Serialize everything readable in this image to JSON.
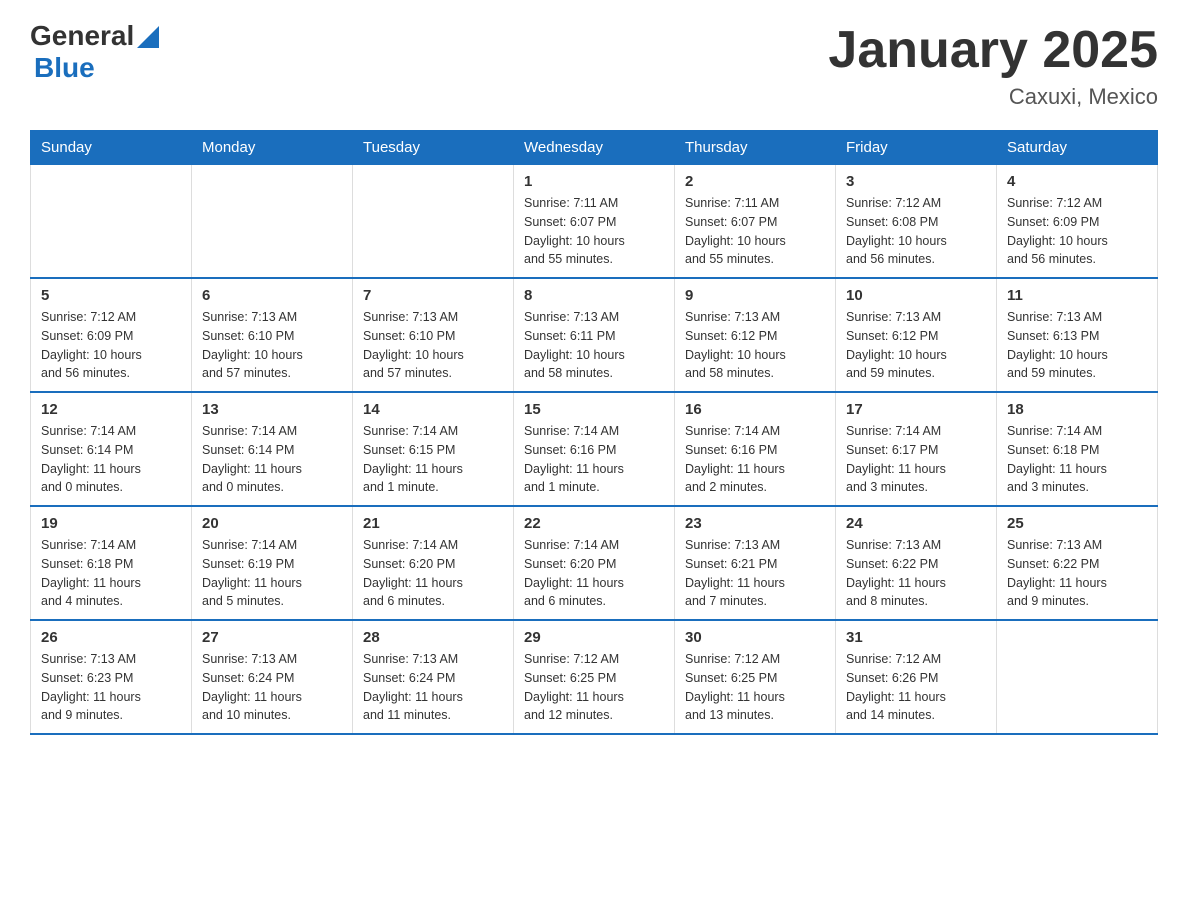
{
  "header": {
    "title": "January 2025",
    "subtitle": "Caxuxi, Mexico",
    "logo_general": "General",
    "logo_blue": "Blue"
  },
  "days_of_week": [
    "Sunday",
    "Monday",
    "Tuesday",
    "Wednesday",
    "Thursday",
    "Friday",
    "Saturday"
  ],
  "weeks": [
    [
      {
        "day": "",
        "info": ""
      },
      {
        "day": "",
        "info": ""
      },
      {
        "day": "",
        "info": ""
      },
      {
        "day": "1",
        "info": "Sunrise: 7:11 AM\nSunset: 6:07 PM\nDaylight: 10 hours\nand 55 minutes."
      },
      {
        "day": "2",
        "info": "Sunrise: 7:11 AM\nSunset: 6:07 PM\nDaylight: 10 hours\nand 55 minutes."
      },
      {
        "day": "3",
        "info": "Sunrise: 7:12 AM\nSunset: 6:08 PM\nDaylight: 10 hours\nand 56 minutes."
      },
      {
        "day": "4",
        "info": "Sunrise: 7:12 AM\nSunset: 6:09 PM\nDaylight: 10 hours\nand 56 minutes."
      }
    ],
    [
      {
        "day": "5",
        "info": "Sunrise: 7:12 AM\nSunset: 6:09 PM\nDaylight: 10 hours\nand 56 minutes."
      },
      {
        "day": "6",
        "info": "Sunrise: 7:13 AM\nSunset: 6:10 PM\nDaylight: 10 hours\nand 57 minutes."
      },
      {
        "day": "7",
        "info": "Sunrise: 7:13 AM\nSunset: 6:10 PM\nDaylight: 10 hours\nand 57 minutes."
      },
      {
        "day": "8",
        "info": "Sunrise: 7:13 AM\nSunset: 6:11 PM\nDaylight: 10 hours\nand 58 minutes."
      },
      {
        "day": "9",
        "info": "Sunrise: 7:13 AM\nSunset: 6:12 PM\nDaylight: 10 hours\nand 58 minutes."
      },
      {
        "day": "10",
        "info": "Sunrise: 7:13 AM\nSunset: 6:12 PM\nDaylight: 10 hours\nand 59 minutes."
      },
      {
        "day": "11",
        "info": "Sunrise: 7:13 AM\nSunset: 6:13 PM\nDaylight: 10 hours\nand 59 minutes."
      }
    ],
    [
      {
        "day": "12",
        "info": "Sunrise: 7:14 AM\nSunset: 6:14 PM\nDaylight: 11 hours\nand 0 minutes."
      },
      {
        "day": "13",
        "info": "Sunrise: 7:14 AM\nSunset: 6:14 PM\nDaylight: 11 hours\nand 0 minutes."
      },
      {
        "day": "14",
        "info": "Sunrise: 7:14 AM\nSunset: 6:15 PM\nDaylight: 11 hours\nand 1 minute."
      },
      {
        "day": "15",
        "info": "Sunrise: 7:14 AM\nSunset: 6:16 PM\nDaylight: 11 hours\nand 1 minute."
      },
      {
        "day": "16",
        "info": "Sunrise: 7:14 AM\nSunset: 6:16 PM\nDaylight: 11 hours\nand 2 minutes."
      },
      {
        "day": "17",
        "info": "Sunrise: 7:14 AM\nSunset: 6:17 PM\nDaylight: 11 hours\nand 3 minutes."
      },
      {
        "day": "18",
        "info": "Sunrise: 7:14 AM\nSunset: 6:18 PM\nDaylight: 11 hours\nand 3 minutes."
      }
    ],
    [
      {
        "day": "19",
        "info": "Sunrise: 7:14 AM\nSunset: 6:18 PM\nDaylight: 11 hours\nand 4 minutes."
      },
      {
        "day": "20",
        "info": "Sunrise: 7:14 AM\nSunset: 6:19 PM\nDaylight: 11 hours\nand 5 minutes."
      },
      {
        "day": "21",
        "info": "Sunrise: 7:14 AM\nSunset: 6:20 PM\nDaylight: 11 hours\nand 6 minutes."
      },
      {
        "day": "22",
        "info": "Sunrise: 7:14 AM\nSunset: 6:20 PM\nDaylight: 11 hours\nand 6 minutes."
      },
      {
        "day": "23",
        "info": "Sunrise: 7:13 AM\nSunset: 6:21 PM\nDaylight: 11 hours\nand 7 minutes."
      },
      {
        "day": "24",
        "info": "Sunrise: 7:13 AM\nSunset: 6:22 PM\nDaylight: 11 hours\nand 8 minutes."
      },
      {
        "day": "25",
        "info": "Sunrise: 7:13 AM\nSunset: 6:22 PM\nDaylight: 11 hours\nand 9 minutes."
      }
    ],
    [
      {
        "day": "26",
        "info": "Sunrise: 7:13 AM\nSunset: 6:23 PM\nDaylight: 11 hours\nand 9 minutes."
      },
      {
        "day": "27",
        "info": "Sunrise: 7:13 AM\nSunset: 6:24 PM\nDaylight: 11 hours\nand 10 minutes."
      },
      {
        "day": "28",
        "info": "Sunrise: 7:13 AM\nSunset: 6:24 PM\nDaylight: 11 hours\nand 11 minutes."
      },
      {
        "day": "29",
        "info": "Sunrise: 7:12 AM\nSunset: 6:25 PM\nDaylight: 11 hours\nand 12 minutes."
      },
      {
        "day": "30",
        "info": "Sunrise: 7:12 AM\nSunset: 6:25 PM\nDaylight: 11 hours\nand 13 minutes."
      },
      {
        "day": "31",
        "info": "Sunrise: 7:12 AM\nSunset: 6:26 PM\nDaylight: 11 hours\nand 14 minutes."
      },
      {
        "day": "",
        "info": ""
      }
    ]
  ]
}
